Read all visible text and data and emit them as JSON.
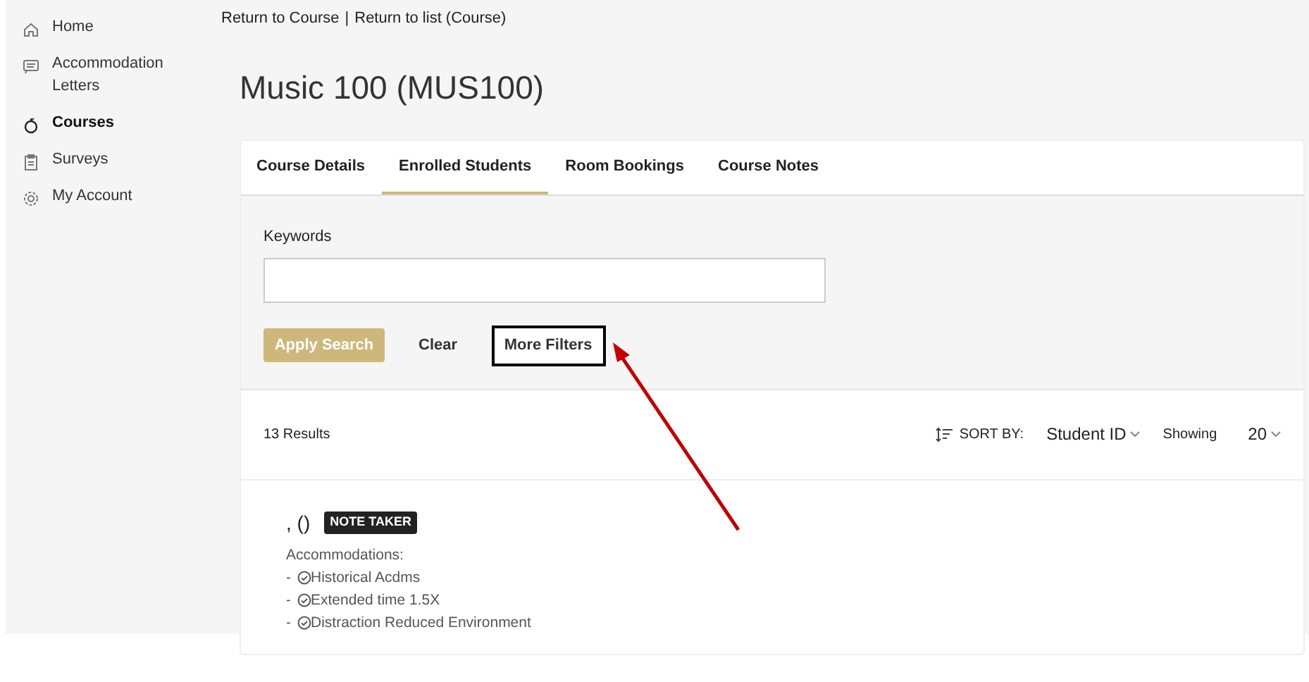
{
  "sidebar": {
    "items": [
      {
        "label": "Home",
        "selected": false
      },
      {
        "label": "Accommodation Letters",
        "selected": false
      },
      {
        "label": "Courses",
        "selected": true
      },
      {
        "label": "Surveys",
        "selected": false
      },
      {
        "label": "My Account",
        "selected": false
      }
    ]
  },
  "breadcrumb": {
    "links": [
      "Return to Course",
      "Return to list (Course)"
    ],
    "separator": "|"
  },
  "title": "Music 100 (MUS100)",
  "tabs": [
    {
      "label": "Course Details",
      "selected": false
    },
    {
      "label": "Enrolled Students",
      "selected": true
    },
    {
      "label": "Room Bookings",
      "selected": false
    },
    {
      "label": "Course Notes",
      "selected": false
    }
  ],
  "search": {
    "label": "Keywords",
    "apply": "Apply Search",
    "clear": "Clear",
    "more_filters": "More Filters"
  },
  "results": {
    "count": "13 Results",
    "sort_label": "SORT BY:",
    "sort_value": "Student ID",
    "showing_label": "Showing",
    "showing_value": "20"
  },
  "students": [
    {
      "name": ", ()",
      "badge": "NOTE TAKER",
      "accommodations_label": "Accommodations:",
      "accommodations": [
        {
          "bullet": "-",
          "label": "Historical Acdms"
        },
        {
          "bullet": "-",
          "label": "Extended time 1.5X"
        },
        {
          "bullet": "-",
          "label": "Distraction Reduced Environment"
        }
      ]
    }
  ],
  "annotation": {
    "kind": "arrow"
  }
}
